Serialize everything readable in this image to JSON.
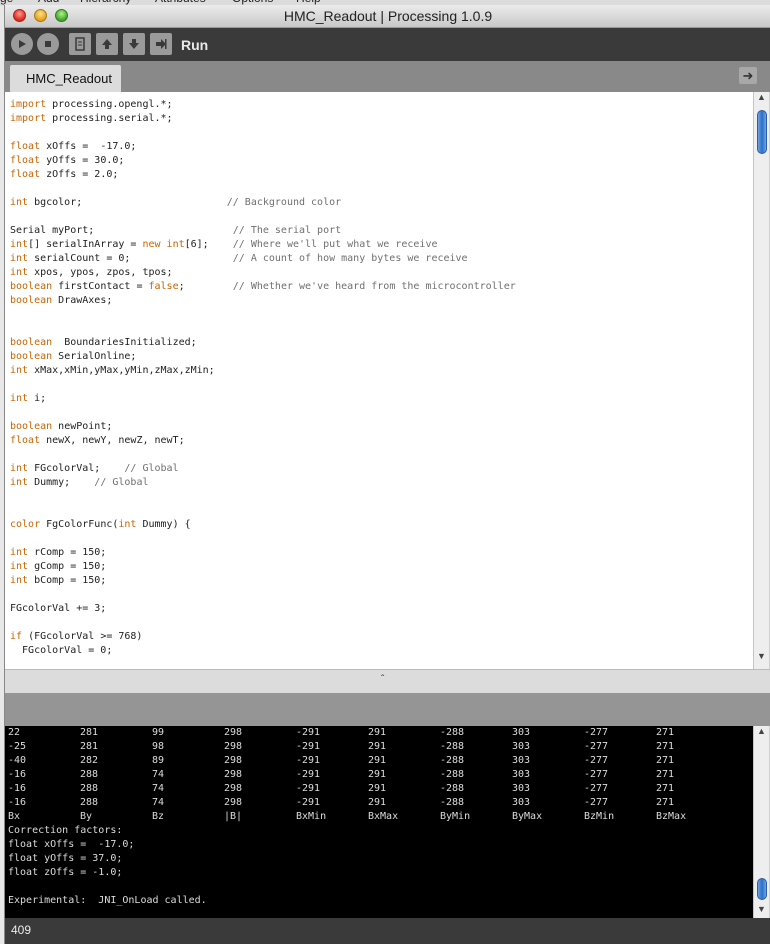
{
  "background_menu": [
    "ge",
    "Add",
    "Hierarchy",
    "Attributes",
    "Options",
    "Help"
  ],
  "window": {
    "title": "HMC_Readout | Processing 1.0.9"
  },
  "toolbar": {
    "run_label": "Run",
    "buttons": [
      "run-icon",
      "stop-icon",
      "new-icon",
      "open-icon",
      "save-icon",
      "export-icon"
    ]
  },
  "tabs": [
    {
      "label": "HMC_Readout"
    }
  ],
  "editor": {
    "lines": [
      [
        {
          "t": "import",
          "c": "kw"
        },
        {
          "t": " processing.opengl.*;"
        }
      ],
      [
        {
          "t": "import",
          "c": "kw"
        },
        {
          "t": " processing.serial.*;"
        }
      ],
      [],
      [
        {
          "t": "float",
          "c": "kw"
        },
        {
          "t": " xOffs =  -17.0;"
        }
      ],
      [
        {
          "t": "float",
          "c": "kw"
        },
        {
          "t": " yOffs = 30.0;"
        }
      ],
      [
        {
          "t": "float",
          "c": "kw"
        },
        {
          "t": " zOffs = 2.0;"
        }
      ],
      [],
      [
        {
          "t": "int",
          "c": "kw"
        },
        {
          "t": " bgcolor;                        "
        },
        {
          "t": "// Background color",
          "c": "cm"
        }
      ],
      [],
      [
        {
          "t": "Serial myPort;                       "
        },
        {
          "t": "// The serial port",
          "c": "cm"
        }
      ],
      [
        {
          "t": "int",
          "c": "kw"
        },
        {
          "t": "[] serialInArray = "
        },
        {
          "t": "new",
          "c": "kw"
        },
        {
          "t": " "
        },
        {
          "t": "int",
          "c": "kw"
        },
        {
          "t": "[6];    "
        },
        {
          "t": "// Where we'll put what we receive",
          "c": "cm"
        }
      ],
      [
        {
          "t": "int",
          "c": "kw"
        },
        {
          "t": " serialCount = 0;                 "
        },
        {
          "t": "// A count of how many bytes we receive",
          "c": "cm"
        }
      ],
      [
        {
          "t": "int",
          "c": "kw"
        },
        {
          "t": " xpos, ypos, zpos, tpos;"
        }
      ],
      [
        {
          "t": "boolean",
          "c": "kw"
        },
        {
          "t": " firstContact = "
        },
        {
          "t": "false",
          "c": "kw"
        },
        {
          "t": ";        "
        },
        {
          "t": "// Whether we've heard from the microcontroller",
          "c": "cm"
        }
      ],
      [
        {
          "t": "boolean",
          "c": "kw"
        },
        {
          "t": " DrawAxes;"
        }
      ],
      [],
      [],
      [
        {
          "t": "boolean",
          "c": "kw"
        },
        {
          "t": "  BoundariesInitialized;"
        }
      ],
      [
        {
          "t": "boolean",
          "c": "kw"
        },
        {
          "t": " SerialOnline;"
        }
      ],
      [
        {
          "t": "int",
          "c": "kw"
        },
        {
          "t": " xMax,xMin,yMax,yMin,zMax,zMin;"
        }
      ],
      [],
      [
        {
          "t": "int",
          "c": "kw"
        },
        {
          "t": " i;"
        }
      ],
      [],
      [
        {
          "t": "boolean",
          "c": "kw"
        },
        {
          "t": " newPoint;"
        }
      ],
      [
        {
          "t": "float",
          "c": "kw"
        },
        {
          "t": " newX, newY, newZ, newT;"
        }
      ],
      [],
      [
        {
          "t": "int",
          "c": "kw"
        },
        {
          "t": " FGcolorVal;    "
        },
        {
          "t": "// Global",
          "c": "cm"
        }
      ],
      [
        {
          "t": "int",
          "c": "kw"
        },
        {
          "t": " Dummy;    "
        },
        {
          "t": "// Global",
          "c": "cm"
        }
      ],
      [],
      [],
      [
        {
          "t": "color",
          "c": "kw"
        },
        {
          "t": " FgColorFunc("
        },
        {
          "t": "int",
          "c": "kw"
        },
        {
          "t": " Dummy) {"
        }
      ],
      [],
      [
        {
          "t": "int",
          "c": "kw"
        },
        {
          "t": " rComp = 150;"
        }
      ],
      [
        {
          "t": "int",
          "c": "kw"
        },
        {
          "t": " gComp = 150;"
        }
      ],
      [
        {
          "t": "int",
          "c": "kw"
        },
        {
          "t": " bComp = 150;"
        }
      ],
      [],
      [
        {
          "t": "FGcolorVal += 3;"
        }
      ],
      [],
      [
        {
          "t": "if",
          "c": "kw"
        },
        {
          "t": " (FGcolorVal >= 768)"
        }
      ],
      [
        {
          "t": "  FGcolorVal = 0;"
        }
      ]
    ]
  },
  "console": {
    "table_rows": [
      [
        "22",
        "281",
        "99",
        "298",
        "-291",
        "291",
        "-288",
        "303",
        "-277",
        "271"
      ],
      [
        "-25",
        "281",
        "98",
        "298",
        "-291",
        "291",
        "-288",
        "303",
        "-277",
        "271"
      ],
      [
        "-40",
        "282",
        "89",
        "298",
        "-291",
        "291",
        "-288",
        "303",
        "-277",
        "271"
      ],
      [
        "-16",
        "288",
        "74",
        "298",
        "-291",
        "291",
        "-288",
        "303",
        "-277",
        "271"
      ],
      [
        "-16",
        "288",
        "74",
        "298",
        "-291",
        "291",
        "-288",
        "303",
        "-277",
        "271"
      ],
      [
        "-16",
        "288",
        "74",
        "298",
        "-291",
        "291",
        "-288",
        "303",
        "-277",
        "271"
      ]
    ],
    "headers": [
      "Bx",
      "By",
      "Bz",
      "|B|",
      "BxMin",
      "BxMax",
      "ByMin",
      "ByMax",
      "BzMin",
      "BzMax"
    ],
    "correction_title": "Correction factors:",
    "corrections": [
      "float xOffs =  -17.0;",
      "float yOffs = 37.0;",
      "float zOffs = -1.0;"
    ],
    "experimental": "Experimental:  JNI_OnLoad called."
  },
  "footer": {
    "line_number": "409"
  },
  "colors": {
    "keyword": "#c86400",
    "comment": "#707070",
    "toolbar": "#3a3a3a",
    "console_bg": "#000000"
  }
}
